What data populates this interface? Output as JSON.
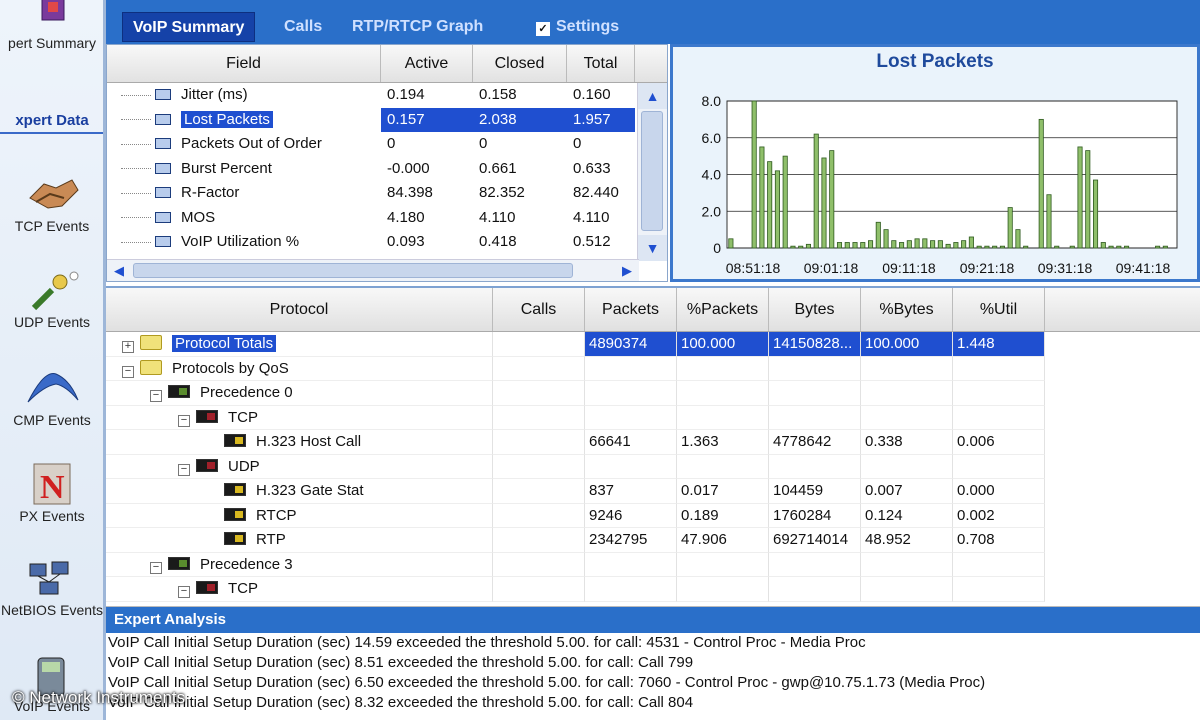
{
  "sidebar": {
    "header": "xpert Data",
    "top_item": "pert Summary",
    "items": [
      {
        "label": "TCP Events",
        "icon": "handshake-icon"
      },
      {
        "label": "UDP Events",
        "icon": "plug-icon"
      },
      {
        "label": "CMP Events",
        "icon": "boomerang-icon"
      },
      {
        "label": "PX Events",
        "icon": "novell-icon"
      },
      {
        "label": "NetBIOS Events",
        "icon": "network-computers-icon"
      },
      {
        "label": "VoIP Events",
        "icon": "phone-icon"
      }
    ]
  },
  "tabs": [
    {
      "label": "VoIP Summary",
      "active": true
    },
    {
      "label": "Calls",
      "active": false
    },
    {
      "label": "RTP/RTCP Graph",
      "active": false
    },
    {
      "label": "Settings",
      "active": false,
      "checkbox": true
    }
  ],
  "summary": {
    "columns": [
      "Field",
      "Active",
      "Closed",
      "Total"
    ],
    "rows": [
      {
        "field": "Jitter (ms)",
        "active": "0.194",
        "closed": "0.158",
        "total": "0.160"
      },
      {
        "field": "Lost Packets",
        "active": "0.157",
        "closed": "2.038",
        "total": "1.957",
        "selected": true
      },
      {
        "field": "Packets Out of Order",
        "active": "0",
        "closed": "0",
        "total": "0"
      },
      {
        "field": "Burst Percent",
        "active": "-0.000",
        "closed": "0.661",
        "total": "0.633"
      },
      {
        "field": "R-Factor",
        "active": "84.398",
        "closed": "82.352",
        "total": "82.440"
      },
      {
        "field": "MOS",
        "active": "4.180",
        "closed": "4.110",
        "total": "4.110"
      },
      {
        "field": "VoIP Utilization %",
        "active": "0.093",
        "closed": "0.418",
        "total": "0.512"
      }
    ]
  },
  "chart_data": {
    "type": "bar",
    "title": "Lost Packets",
    "ylim": [
      0,
      8.0
    ],
    "yticks": [
      "8.0",
      "6.0",
      "4.0",
      "2.0",
      "0"
    ],
    "xticks": [
      "08:51:18",
      "09:01:18",
      "09:11:18",
      "09:21:18",
      "09:31:18",
      "09:41:18"
    ],
    "bar_color": "#8fbf6a",
    "values": [
      0.5,
      0,
      0,
      8.0,
      5.5,
      4.7,
      4.2,
      5.0,
      0.1,
      0.1,
      0.2,
      6.2,
      4.9,
      5.3,
      0.3,
      0.3,
      0.3,
      0.3,
      0.4,
      1.4,
      1.0,
      0.4,
      0.3,
      0.4,
      0.5,
      0.5,
      0.4,
      0.4,
      0.2,
      0.3,
      0.4,
      0.6,
      0.1,
      0.1,
      0.1,
      0.1,
      2.2,
      1.0,
      0.1,
      0,
      7.0,
      2.9,
      0.1,
      0,
      0.1,
      5.5,
      5.3,
      3.7,
      0.3,
      0.1,
      0.1,
      0.1,
      0,
      0,
      0,
      0.1,
      0.1,
      0
    ]
  },
  "protocols": {
    "columns": [
      "Protocol",
      "Calls",
      "Packets",
      "%Packets",
      "Bytes",
      "%Bytes",
      "%Util"
    ],
    "rows": [
      {
        "name": "Protocol Totals",
        "level": 0,
        "expander": "+",
        "icon": "folder",
        "calls": "",
        "packets": "4890374",
        "pct_packets": "100.000",
        "bytes": "14150828...",
        "pct_bytes": "100.000",
        "util": "1.448",
        "selected": true
      },
      {
        "name": "Protocols by QoS",
        "level": 0,
        "expander": "-",
        "icon": "folder",
        "calls": "",
        "packets": "",
        "pct_packets": "",
        "bytes": "",
        "pct_bytes": "",
        "util": ""
      },
      {
        "name": "Precedence 0",
        "level": 1,
        "expander": "-",
        "icon": "pic-green",
        "calls": "",
        "packets": "",
        "pct_packets": "",
        "bytes": "",
        "pct_bytes": "",
        "util": ""
      },
      {
        "name": "TCP",
        "level": 2,
        "expander": "-",
        "icon": "pic-red",
        "calls": "",
        "packets": "",
        "pct_packets": "",
        "bytes": "",
        "pct_bytes": "",
        "util": ""
      },
      {
        "name": "H.323 Host Call",
        "level": 3,
        "expander": "",
        "icon": "pic-yel",
        "calls": "",
        "packets": "66641",
        "pct_packets": "1.363",
        "bytes": "4778642",
        "pct_bytes": "0.338",
        "util": "0.006"
      },
      {
        "name": "UDP",
        "level": 2,
        "expander": "-",
        "icon": "pic-red",
        "calls": "",
        "packets": "",
        "pct_packets": "",
        "bytes": "",
        "pct_bytes": "",
        "util": ""
      },
      {
        "name": "H.323 Gate Stat",
        "level": 3,
        "expander": "",
        "icon": "pic-yel",
        "calls": "",
        "packets": "837",
        "pct_packets": "0.017",
        "bytes": "104459",
        "pct_bytes": "0.007",
        "util": "0.000"
      },
      {
        "name": "RTCP",
        "level": 3,
        "expander": "",
        "icon": "pic-yel",
        "calls": "",
        "packets": "9246",
        "pct_packets": "0.189",
        "bytes": "1760284",
        "pct_bytes": "0.124",
        "util": "0.002"
      },
      {
        "name": "RTP",
        "level": 3,
        "expander": "",
        "icon": "pic-yel",
        "calls": "",
        "packets": "2342795",
        "pct_packets": "47.906",
        "bytes": "692714014",
        "pct_bytes": "48.952",
        "util": "0.708"
      },
      {
        "name": "Precedence 3",
        "level": 1,
        "expander": "-",
        "icon": "pic-green",
        "calls": "",
        "packets": "",
        "pct_packets": "",
        "bytes": "",
        "pct_bytes": "",
        "util": ""
      },
      {
        "name": "TCP",
        "level": 2,
        "expander": "-",
        "icon": "pic-red",
        "calls": "",
        "packets": "",
        "pct_packets": "",
        "bytes": "",
        "pct_bytes": "",
        "util": ""
      }
    ]
  },
  "analysis": {
    "title": "Expert Analysis",
    "lines": [
      "VoIP Call Initial Setup Duration (sec) 14.59 exceeded the threshold 5.00. for call: 4531 - Control Proc - Media Proc",
      "VoIP Call Initial Setup Duration (sec) 8.51 exceeded the threshold 5.00. for call: Call 799",
      "VoIP Call Initial Setup Duration (sec) 6.50 exceeded the threshold 5.00. for call: 7060 - Control Proc - gwp@10.75.1.73 (Media Proc)",
      "VoIP Call Initial Setup Duration (sec) 8.32 exceeded the threshold 5.00. for call: Call 804"
    ]
  },
  "copyright": "© Network Instruments"
}
